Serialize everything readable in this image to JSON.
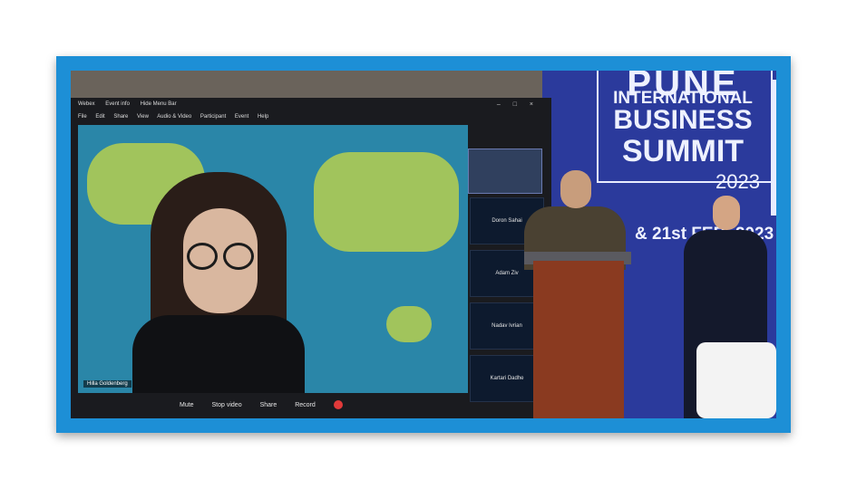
{
  "banner": {
    "line1": "PUNE",
    "line2": "INTERNATIONAL",
    "line3": "BUSINESS",
    "line4": "SUMMIT",
    "year": "2023",
    "date": "& 21st FEB. 2023"
  },
  "zoom": {
    "menu": [
      "Webex",
      "Event info",
      "Hide Menu Bar"
    ],
    "menu_items": [
      "File",
      "Edit",
      "Share",
      "View",
      "Audio & Video",
      "Participant",
      "Event",
      "Help"
    ],
    "participant_name": "Hilla Goldenberg",
    "controls": [
      "Mute",
      "Stop video",
      "Share",
      "Record"
    ],
    "tiles": [
      "Doron Sahai",
      "Adam Ziv",
      "Nadav Ivrian",
      "Kartari Dadhe"
    ]
  },
  "colors": {
    "frame": "#1d8fd6",
    "banner": "#2b3a9c",
    "record": "#e13a3a"
  }
}
